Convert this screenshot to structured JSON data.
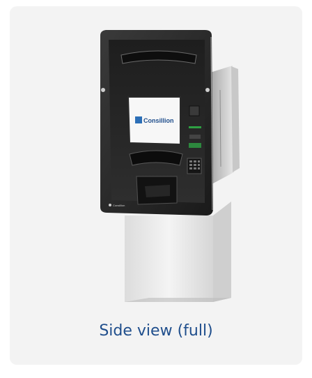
{
  "caption": "Side view (full)",
  "logo_text": "Consillion",
  "badge_text": "Consillion"
}
